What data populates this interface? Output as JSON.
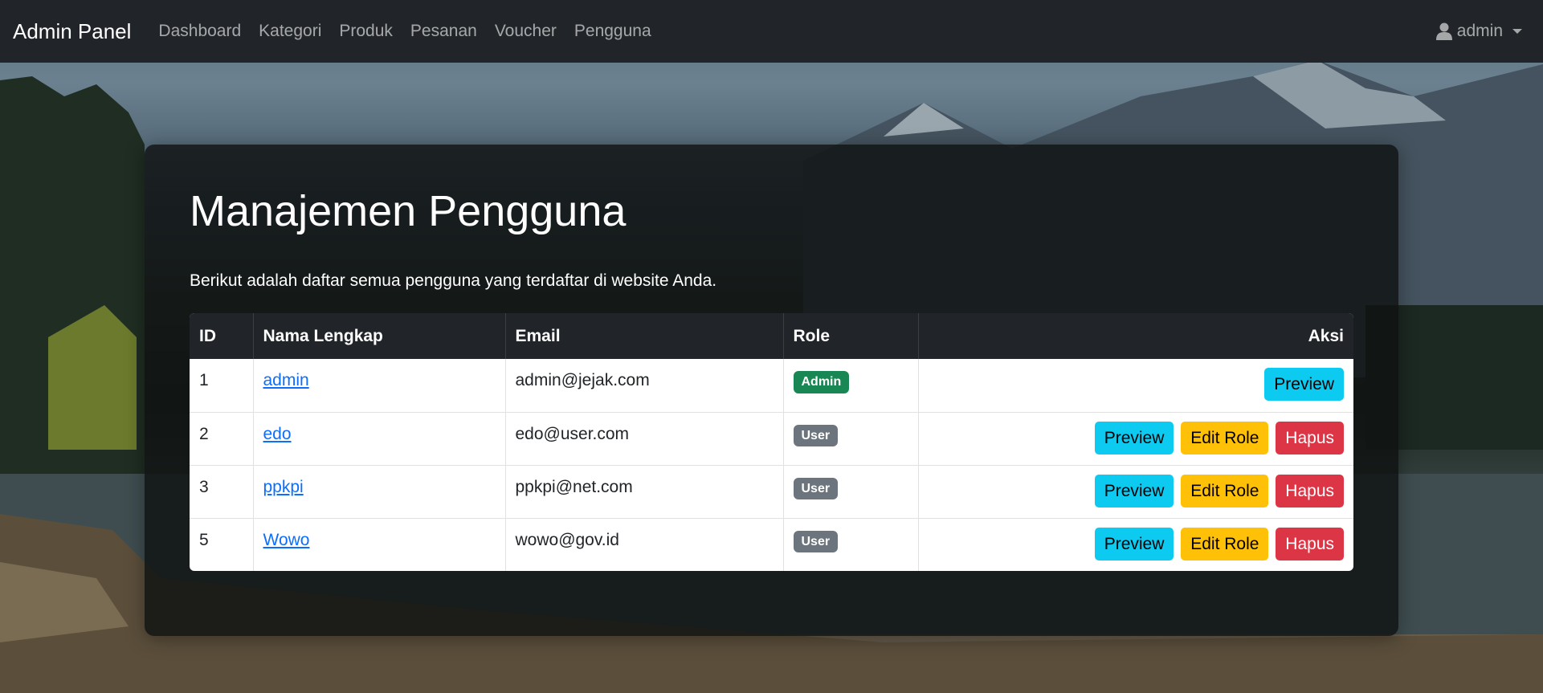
{
  "navbar": {
    "brand": "Admin Panel",
    "links": [
      "Dashboard",
      "Kategori",
      "Produk",
      "Pesanan",
      "Voucher",
      "Pengguna"
    ],
    "user": "admin",
    "user_icon": "person-icon"
  },
  "page": {
    "title": "Manajemen Pengguna",
    "description": "Berikut adalah daftar semua pengguna yang terdaftar di website Anda."
  },
  "table": {
    "headers": [
      "ID",
      "Nama Lengkap",
      "Email",
      "Role",
      "Aksi"
    ],
    "rows": [
      {
        "id": "1",
        "name": "admin",
        "email": "admin@jejak.com",
        "role": "Admin",
        "actions": [
          "Preview"
        ]
      },
      {
        "id": "2",
        "name": "edo",
        "email": "edo@user.com",
        "role": "User",
        "actions": [
          "Preview",
          "Edit Role",
          "Hapus"
        ]
      },
      {
        "id": "3",
        "name": "ppkpi",
        "email": "ppkpi@net.com",
        "role": "User",
        "actions": [
          "Preview",
          "Edit Role",
          "Hapus"
        ]
      },
      {
        "id": "5",
        "name": "Wowo",
        "email": "wowo@gov.id",
        "role": "User",
        "actions": [
          "Preview",
          "Edit Role",
          "Hapus"
        ]
      }
    ]
  },
  "colors": {
    "navbar_bg": "#212529",
    "admin_badge": "#198754",
    "user_badge": "#6c757d",
    "preview": "#0dcaf0",
    "edit": "#ffc107",
    "delete": "#dc3545",
    "link": "#0d6efd"
  }
}
